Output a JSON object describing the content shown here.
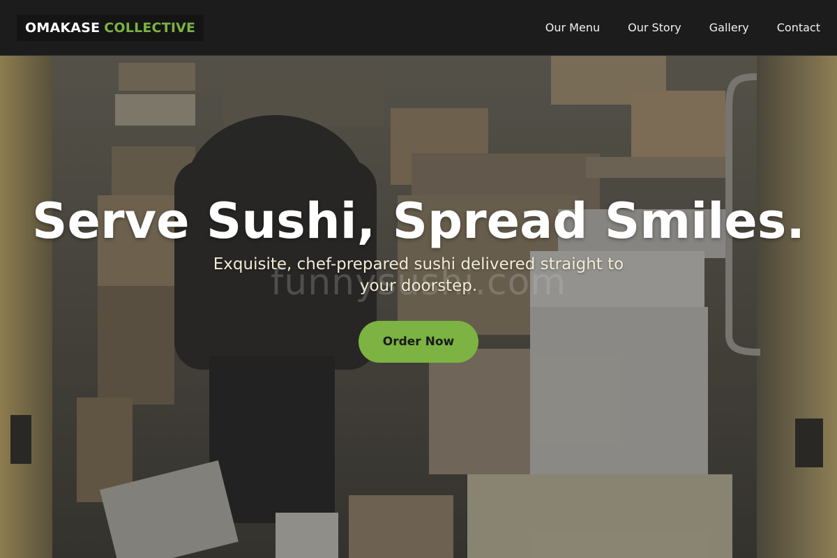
{
  "brand": {
    "name_main": "OMAKASE",
    "name_accent": "COLLECTIVE",
    "accent_color": "#7cb342"
  },
  "nav": {
    "items": [
      {
        "label": "Our Menu"
      },
      {
        "label": "Our Story"
      },
      {
        "label": "Gallery"
      },
      {
        "label": "Contact"
      }
    ]
  },
  "hero": {
    "headline": "Serve Sushi, Spread Smiles.",
    "subtitle": "Exquisite, chef-prepared sushi delivered straight to your doorstep.",
    "cta_label": "Order Now",
    "watermark": "funnysushi.com",
    "background_image": "delivery-van-packages-photo"
  }
}
